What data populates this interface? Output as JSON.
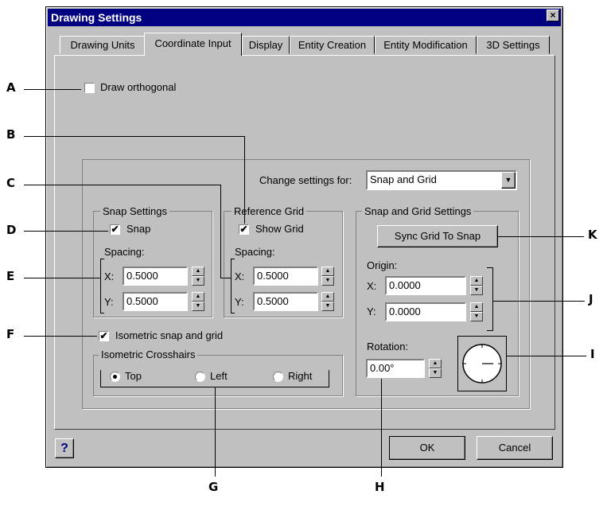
{
  "dialog": {
    "title": "Drawing Settings",
    "close_glyph": "×",
    "tabs": [
      "Drawing Units",
      "Coordinate Input",
      "Display",
      "Entity Creation",
      "Entity Modification",
      "3D Settings"
    ],
    "active_tab": "Coordinate Input",
    "draw_orthogonal": {
      "label": "Draw orthogonal",
      "checked": false
    },
    "change_settings_for": {
      "label": "Change settings for:",
      "value": "Snap and Grid"
    },
    "snap_settings": {
      "title": "Snap Settings",
      "snap": {
        "label": "Snap",
        "checked": true
      },
      "spacing_label": "Spacing:",
      "x_label": "X:",
      "x_value": "0.5000",
      "y_label": "Y:",
      "y_value": "0.5000"
    },
    "reference_grid": {
      "title": "Reference Grid",
      "show_grid": {
        "label": "Show Grid",
        "checked": true
      },
      "spacing_label": "Spacing:",
      "x_label": "X:",
      "x_value": "0.5000",
      "y_label": "Y:",
      "y_value": "0.5000"
    },
    "isometric": {
      "label": "Isometric snap and grid",
      "checked": true
    },
    "isometric_crosshairs": {
      "title": "Isometric Crosshairs",
      "options": [
        "Top",
        "Left",
        "Right"
      ],
      "selected": "Top"
    },
    "snap_grid_settings": {
      "title": "Snap and Grid Settings",
      "sync_button": "Sync Grid To Snap",
      "origin_label": "Origin:",
      "x_label": "X:",
      "x_value": "0.0000",
      "y_label": "Y:",
      "y_value": "0.0000",
      "rotation_label": "Rotation:",
      "rotation_value": "0.00°"
    },
    "help_glyph": "?",
    "ok_label": "OK",
    "cancel_label": "Cancel"
  },
  "callouts": [
    "A",
    "B",
    "C",
    "D",
    "E",
    "F",
    "G",
    "H",
    "I",
    "J",
    "K"
  ],
  "colors": {
    "titlebar": "#000080",
    "face": "#c0c0c0",
    "help": "#000080"
  }
}
